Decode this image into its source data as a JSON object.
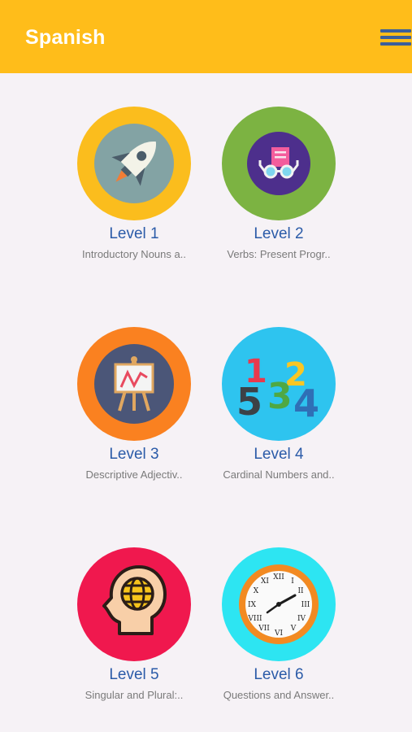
{
  "app_bar": {
    "title": "Spanish",
    "menu_icon": "hamburger-menu-icon",
    "background": "#ffbd1a"
  },
  "levels": [
    {
      "title": "Level 1",
      "subtitle": "Introductory Nouns a..",
      "icon": "rocket-icon",
      "ring_color": "#fbbd1d",
      "inner_color": "#83a3a4"
    },
    {
      "title": "Level 2",
      "subtitle": "Verbs: Present Progr..",
      "icon": "reading-glasses-icon",
      "ring_color": "#7cb342",
      "inner_color": "#4d2f8c"
    },
    {
      "title": "Level 3",
      "subtitle": "Descriptive Adjectiv..",
      "icon": "presentation-easel-icon",
      "ring_color": "#fa8120",
      "inner_color": "#4b5678"
    },
    {
      "title": "Level 4",
      "subtitle": "Cardinal Numbers and..",
      "icon": "numbers-icon",
      "ring_color": "#2ec4ef",
      "inner_color": "#2ec4ef"
    },
    {
      "title": "Level 5",
      "subtitle": "Singular and Plural:..",
      "icon": "head-globe-icon",
      "ring_color": "#f0184e",
      "inner_color": "#f0184e"
    },
    {
      "title": "Level 6",
      "subtitle": "Questions and Answer..",
      "icon": "clock-icon",
      "ring_color": "#2de5f2",
      "inner_color": "#f28a22"
    }
  ]
}
